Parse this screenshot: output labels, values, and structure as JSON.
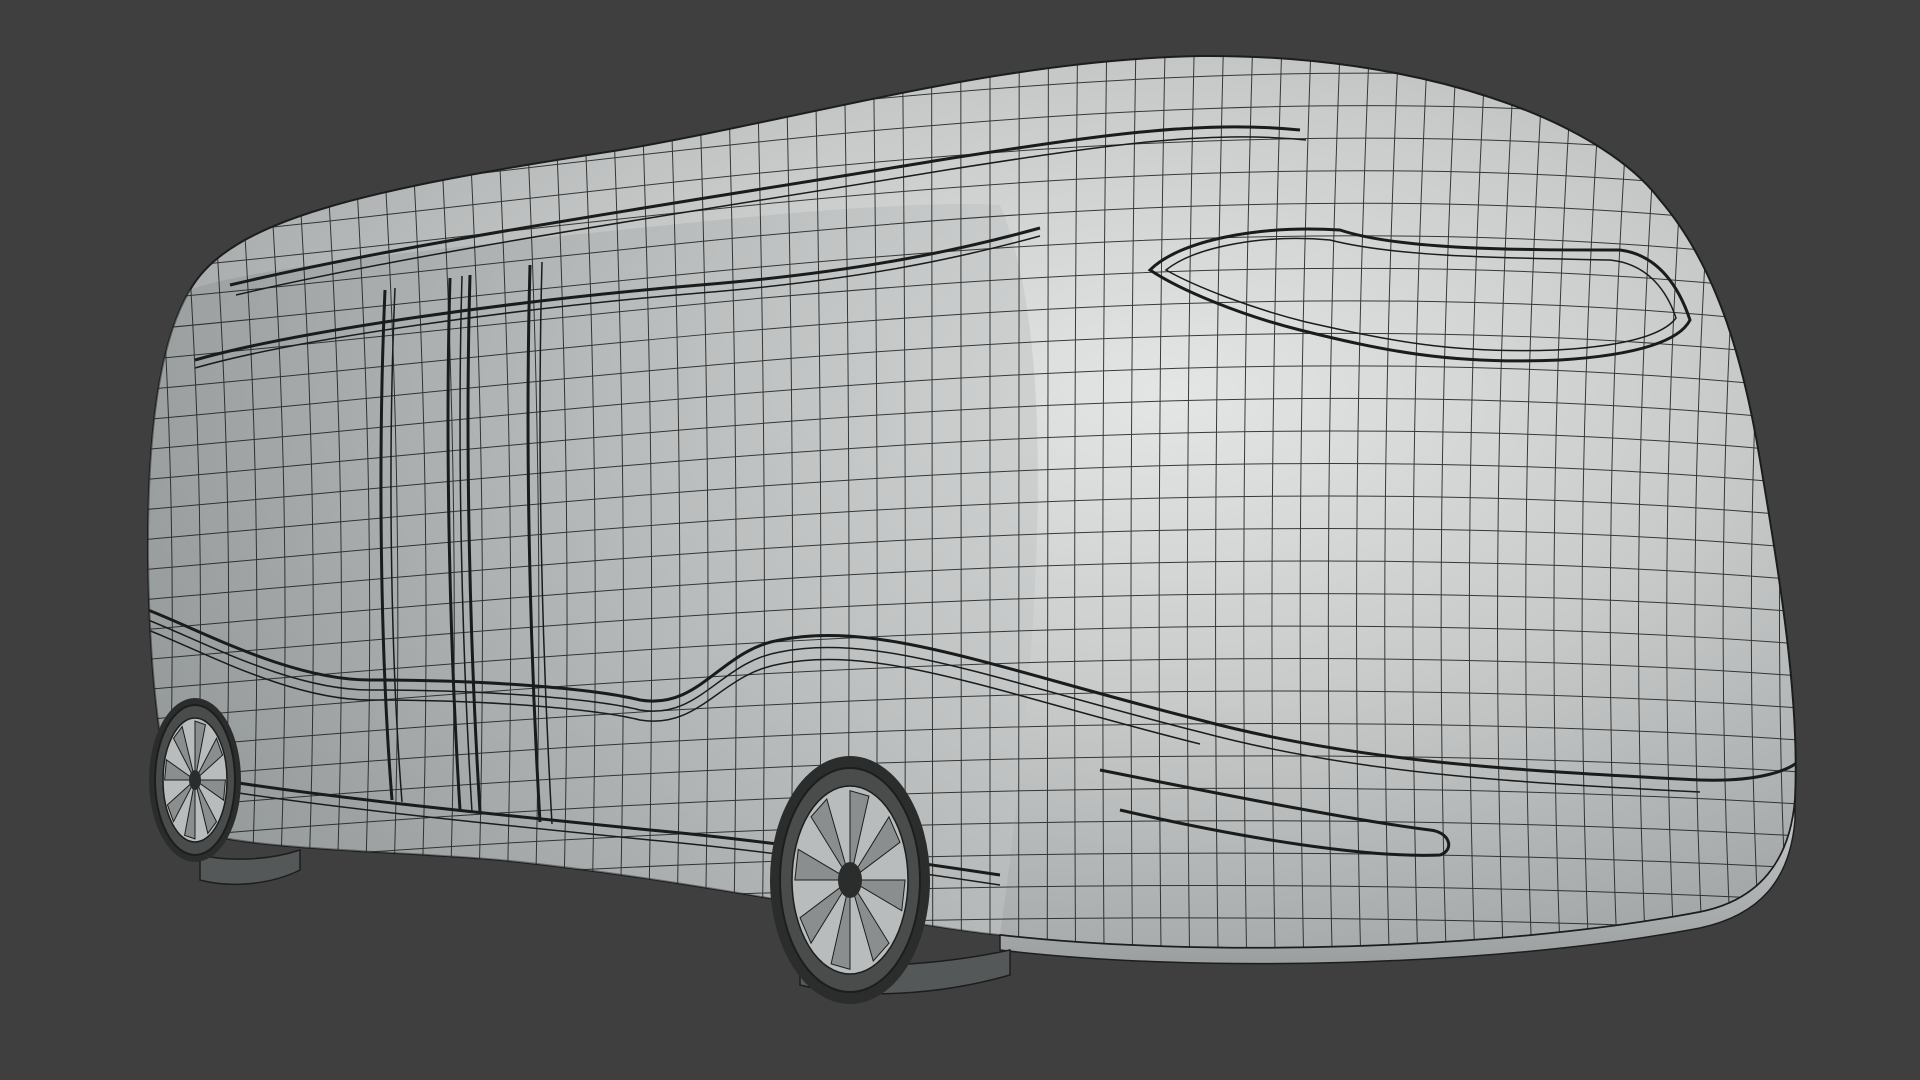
{
  "viewport": {
    "background_color": "#3f3f3f",
    "display_mode": "wireframe-over-solid",
    "object": "bus-body-mesh",
    "mesh_fill_color": "#c3c6c6",
    "mesh_highlight_color": "#e2e3e3",
    "mesh_shadow_color": "#8e9292",
    "wire_color": "#1c1e1e",
    "tire_color": "#4a4c4c",
    "rim_color": "#b9bcbc"
  }
}
